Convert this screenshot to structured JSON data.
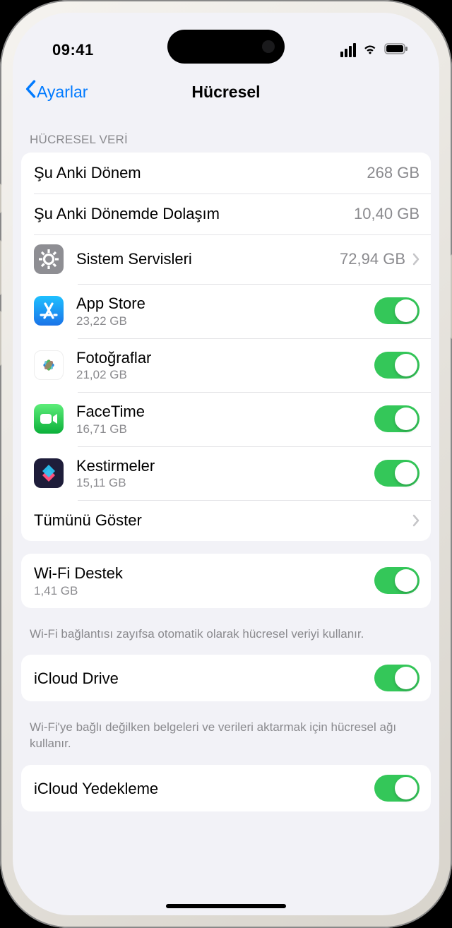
{
  "status": {
    "time": "09:41"
  },
  "nav": {
    "back": "Ayarlar",
    "title": "Hücresel"
  },
  "section_header": "HÜCRESEL VERİ",
  "period": {
    "label": "Şu Anki Dönem",
    "value": "268 GB"
  },
  "roaming": {
    "label": "Şu Anki Dönemde Dolaşım",
    "value": "10,40 GB"
  },
  "system": {
    "label": "Sistem Servisleri",
    "value": "72,94 GB"
  },
  "apps": [
    {
      "name": "App Store",
      "usage": "23,22 GB",
      "on": true
    },
    {
      "name": "Fotoğraflar",
      "usage": "21,02 GB",
      "on": true
    },
    {
      "name": "FaceTime",
      "usage": "16,71 GB",
      "on": true
    },
    {
      "name": "Kestirmeler",
      "usage": "15,11 GB",
      "on": true
    }
  ],
  "show_all": "Tümünü Göster",
  "wifi_assist": {
    "label": "Wi-Fi Destek",
    "usage": "1,41 GB",
    "on": true,
    "footer": "Wi-Fi bağlantısı zayıfsa otomatik olarak hücresel veriyi kullanır."
  },
  "icloud_drive": {
    "label": "iCloud Drive",
    "on": true,
    "footer": "Wi-Fi'ye bağlı değilken belgeleri ve verileri aktarmak için hücresel ağı kullanır."
  },
  "icloud_backup": {
    "label": "iCloud Yedekleme",
    "on": true
  }
}
